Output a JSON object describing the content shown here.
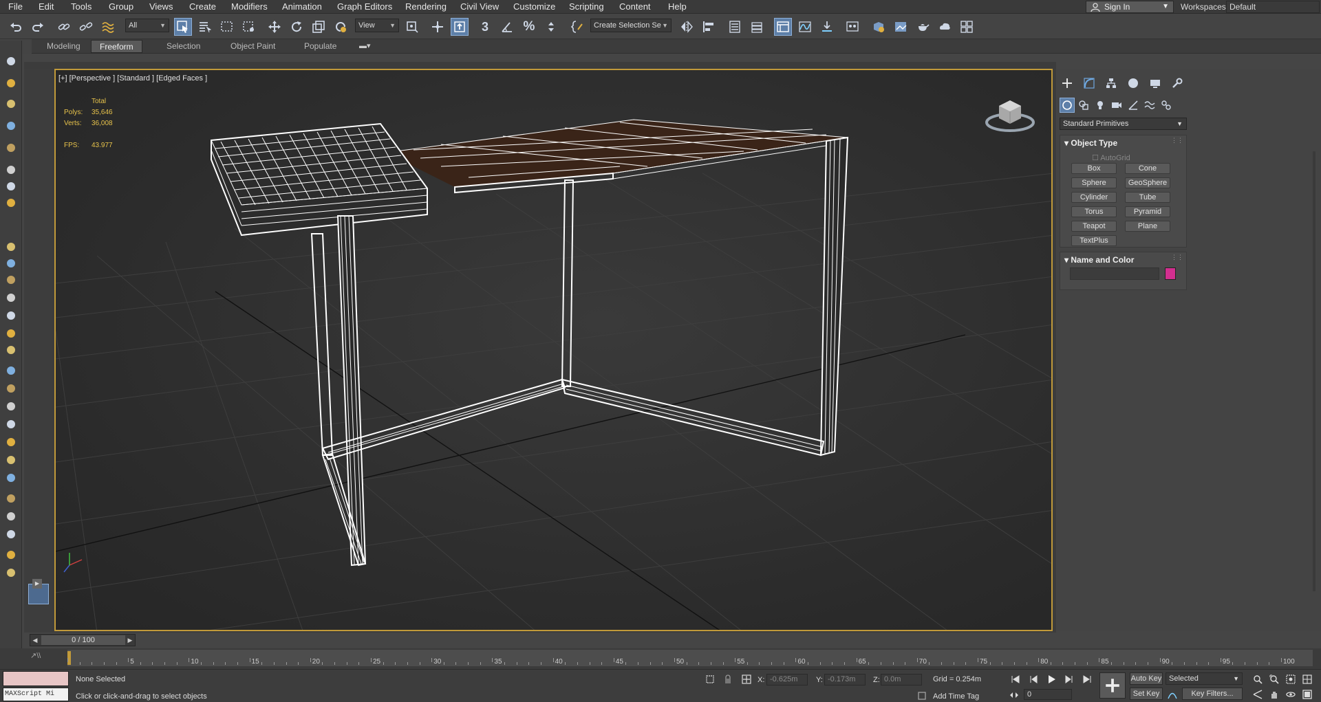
{
  "menu": {
    "items": [
      "File",
      "Edit",
      "Tools",
      "Group",
      "Views",
      "Create",
      "Modifiers",
      "Animation",
      "Graph Editors",
      "Rendering",
      "Civil View",
      "Customize",
      "Scripting",
      "Content",
      "Help"
    ],
    "sign_in": "Sign In",
    "workspaces_label": "Workspaces:",
    "workspace": "Default"
  },
  "toolbar": {
    "selection_filter": "All",
    "reference_coord": "View",
    "named_selection": "Create Selection Se",
    "snap_label": "3",
    "percent_label": "%"
  },
  "ribbon": {
    "tabs": [
      "Modeling",
      "Freeform",
      "Selection",
      "Object Paint",
      "Populate"
    ],
    "active_tab": "Freeform"
  },
  "viewport": {
    "label": "[+] [Perspective ] [Standard ] [Edged Faces ]",
    "stats_header": "Total",
    "polys_label": "Polys:",
    "polys": "35,646",
    "verts_label": "Verts:",
    "verts": "36,008",
    "fps_label": "FPS:",
    "fps": "43.977"
  },
  "command_panel": {
    "category": "Standard Primitives",
    "object_type_title": "Object Type",
    "autogrid": "AutoGrid",
    "primitives": [
      "Box",
      "Cone",
      "Sphere",
      "GeoSphere",
      "Cylinder",
      "Tube",
      "Torus",
      "Pyramid",
      "Teapot",
      "Plane",
      "TextPlus"
    ],
    "name_color_title": "Name and Color",
    "object_color": "#d22f8f"
  },
  "timeline": {
    "frame_display": "0 / 100",
    "ticks": [
      "0",
      "5",
      "10",
      "15",
      "20",
      "25",
      "30",
      "35",
      "40",
      "45",
      "50",
      "55",
      "60",
      "65",
      "70",
      "75",
      "80",
      "85",
      "90",
      "95",
      "100"
    ]
  },
  "status": {
    "maxscript": "MAXScript Mi",
    "selection": "None Selected",
    "prompt": "Click or click-and-drag to select objects",
    "x_label": "X:",
    "x_value": "-0.625m",
    "y_label": "Y:",
    "y_value": "-0.173m",
    "z_label": "Z:",
    "z_value": "0.0m",
    "grid": "Grid = 0.254m",
    "add_time_tag": "Add Time Tag",
    "auto_key": "Auto Key",
    "set_key": "Set Key",
    "key_mode": "Selected",
    "key_filters": "Key Filters...",
    "current_frame": "0"
  },
  "colors": {
    "accent": "#5d7fa8",
    "viewport_border": "#c19a3a",
    "stats_text": "#e8c34b",
    "wireframe": "#ffffff",
    "tabletop_wood": "#3a2418"
  }
}
